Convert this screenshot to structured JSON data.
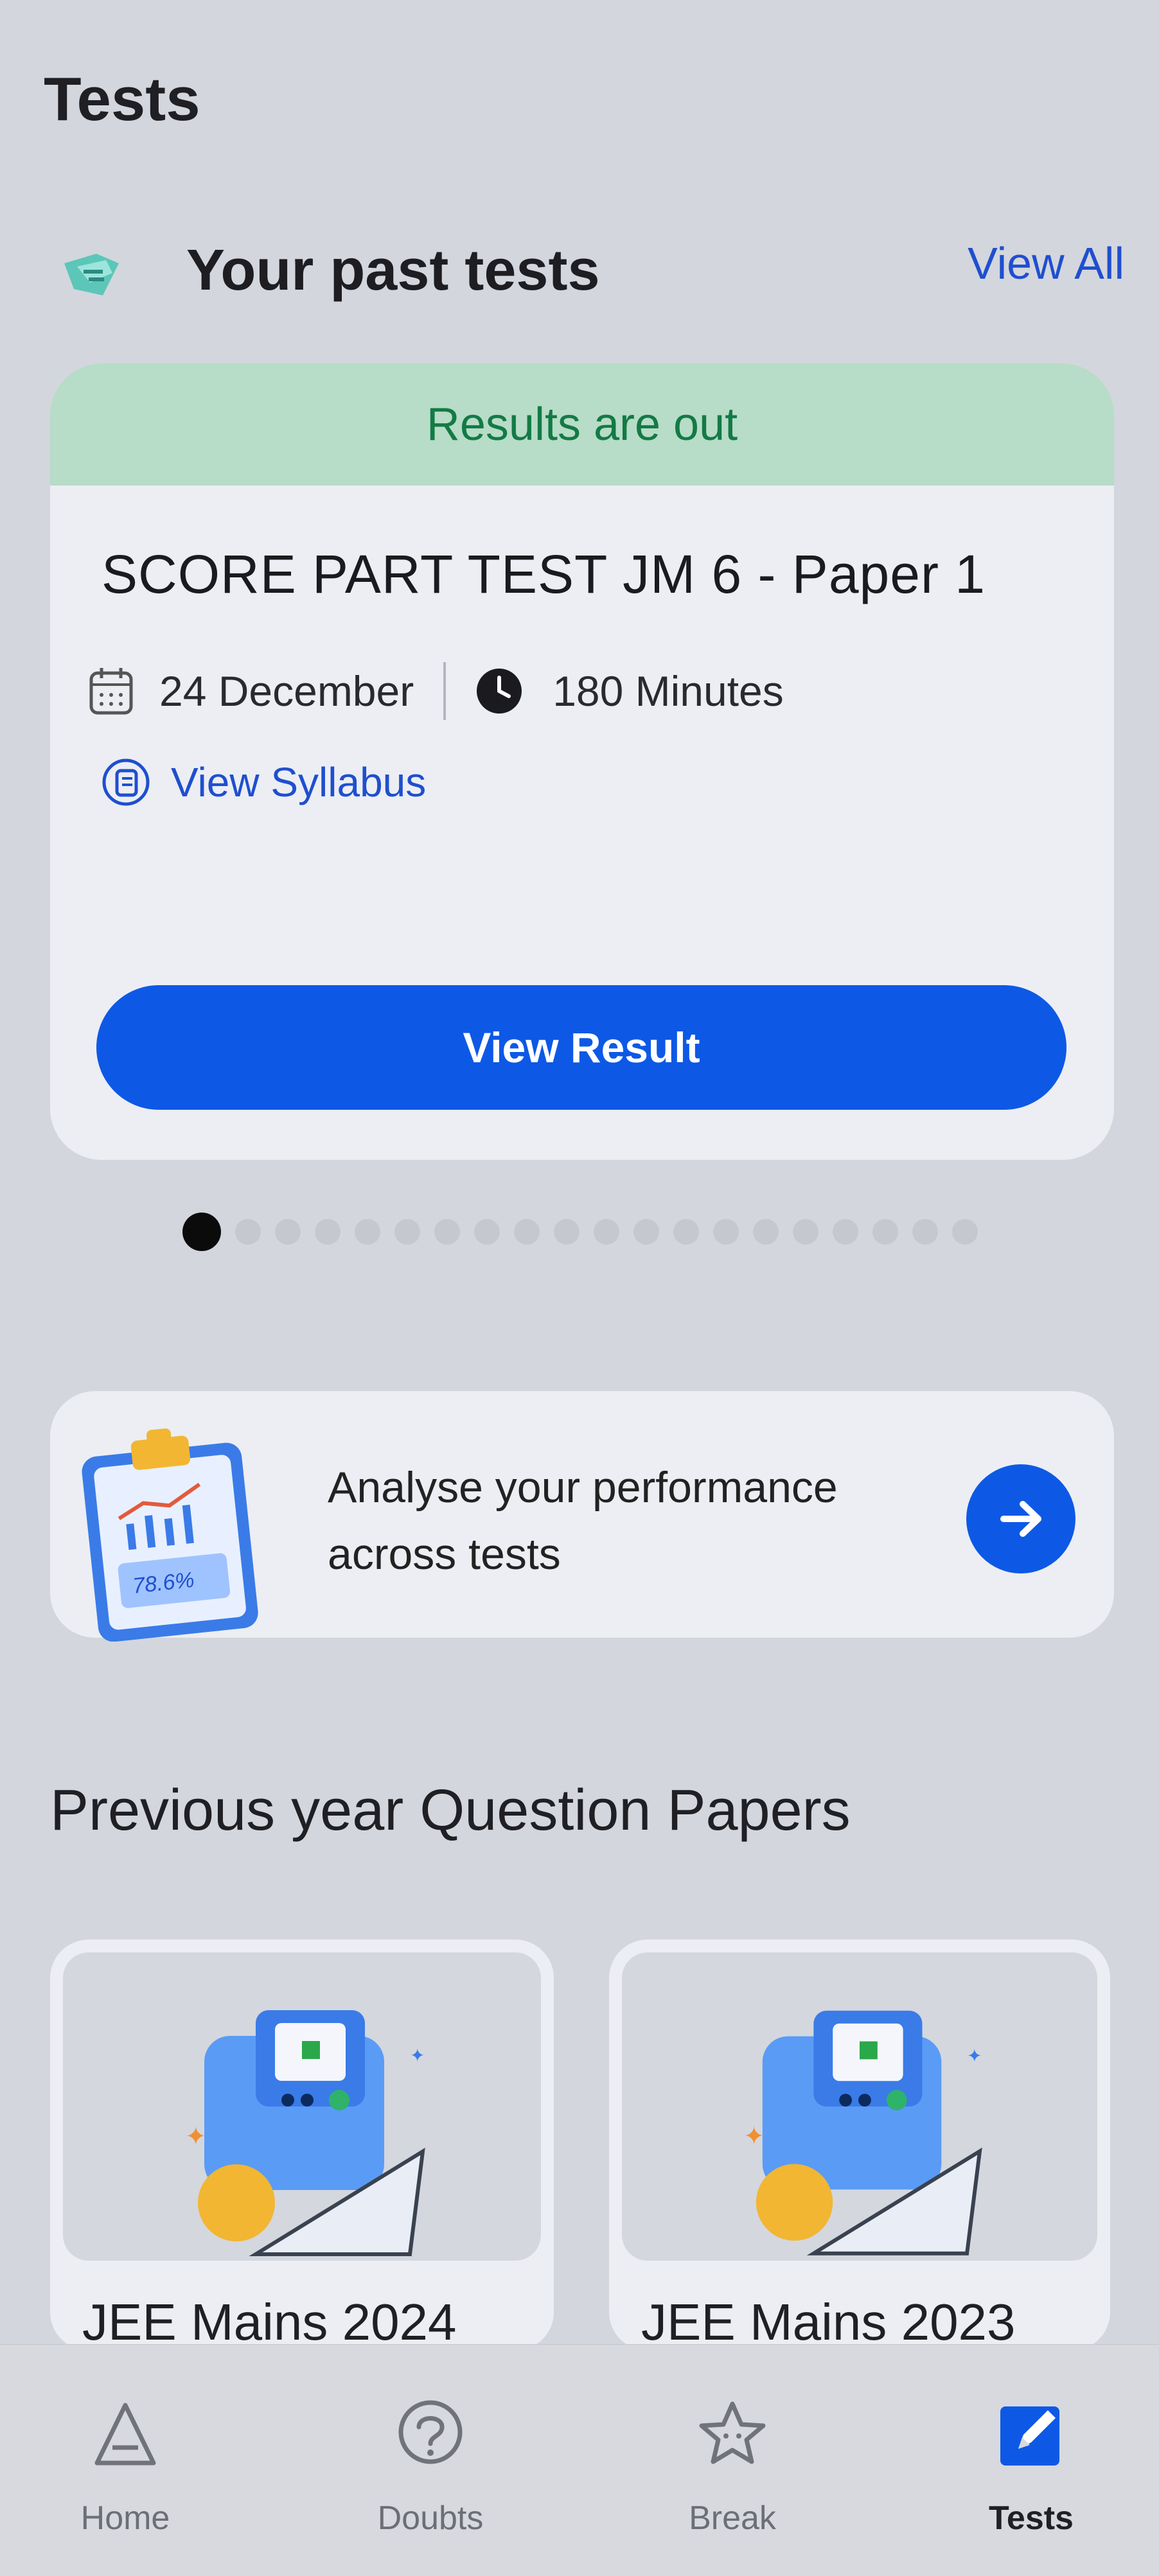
{
  "header": {
    "title": "Tests"
  },
  "past_tests": {
    "section_title": "Your past tests",
    "view_all": "View All",
    "card": {
      "banner": "Results are out",
      "name": "SCORE PART TEST JM 6 - Paper 1",
      "date": "24 December",
      "duration": "180 Minutes",
      "syllabus_link": "View Syllabus",
      "cta": "View Result"
    },
    "carousel": {
      "total": 20,
      "active_index": 0
    }
  },
  "analyse": {
    "line1": "Analyse your performance",
    "line2": "across tests",
    "illustration_value": "78.6%"
  },
  "previous_papers": {
    "section_title": "Previous year Question Papers",
    "cards": [
      {
        "label": "JEE Mains 2024"
      },
      {
        "label": "JEE Mains 2023"
      }
    ]
  },
  "bottom_nav": {
    "items": [
      {
        "label": "Home",
        "icon": "home-icon"
      },
      {
        "label": "Doubts",
        "icon": "question-icon"
      },
      {
        "label": "Break",
        "icon": "star-icon"
      },
      {
        "label": "Tests",
        "icon": "edit-icon"
      }
    ],
    "active": "Tests"
  },
  "colors": {
    "accent": "#0d59e6",
    "banner_bg": "#b7dcc7",
    "banner_text": "#137a45",
    "link": "#1f4fcf"
  }
}
